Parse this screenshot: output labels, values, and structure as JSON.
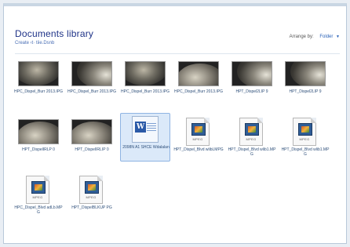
{
  "library": {
    "title": "Documents library",
    "subtitle": "Create ‹t· tiie.Dsnb",
    "arrange_label": "Arrange by:",
    "arrange_value": "Folder"
  },
  "items": [
    {
      "kind": "photo",
      "icon": "photo-thumbnail",
      "label": "HPC_Dispel_Burr 2013.IPG"
    },
    {
      "kind": "photo",
      "icon": "photo-thumbnail",
      "label": "HPC_Dispel_Burr 2013.IPG"
    },
    {
      "kind": "photo",
      "icon": "photo-thumbnail",
      "label": "HPC_Dispel_Burr 2013.IPG"
    },
    {
      "kind": "photo",
      "icon": "photo-thumbnail",
      "label": "HPC_Dispel_Burr 2013.IPG"
    },
    {
      "kind": "photo",
      "icon": "photo-thumbnail",
      "label": "HPT_Dispel2LIP 9"
    },
    {
      "kind": "photo",
      "icon": "photo-thumbnail",
      "label": "HPT_Dispel2LIP 9"
    },
    {
      "kind": "photo",
      "icon": "photo-thumbnail",
      "label": "HPT_DispelIRLP 0"
    },
    {
      "kind": "photo",
      "icon": "photo-thumbnail",
      "label": "HPT_DispelIRLIP 0"
    },
    {
      "kind": "word",
      "icon": "word-document-icon",
      "label": "2098N A1 SHCE Wdalalan"
    },
    {
      "kind": "video",
      "icon": "mpeg-video-icon",
      "tag": "MPEG",
      "label": "HPT_Dispel_Blvd wlibLMPG"
    },
    {
      "kind": "video",
      "icon": "mpeg-video-icon",
      "tag": "MPEG",
      "label": "HPT_Dispel_Blvd wlib1.MPG"
    },
    {
      "kind": "video",
      "icon": "mpeg-video-icon",
      "tag": "MPEG",
      "label": "HPT_Dispel_Blvd wlib1.MPG"
    },
    {
      "kind": "video",
      "icon": "mpeg-video-icon",
      "tag": "MPEG",
      "label": "HPC_Dispel_Blvd adLb.MPG"
    },
    {
      "kind": "video",
      "icon": "mpeg-video-icon",
      "tag": "MPEG",
      "label": "HPT_DispelBLKUP PG"
    }
  ]
}
